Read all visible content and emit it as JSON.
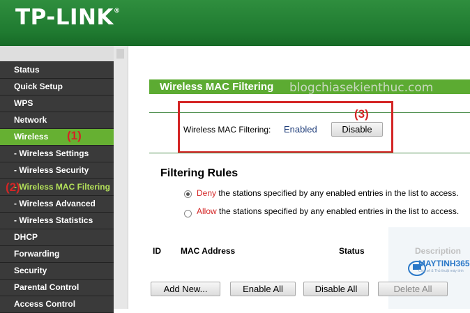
{
  "brand": {
    "name": "TP-LINK",
    "mark": "®"
  },
  "sidebar": {
    "items": [
      {
        "label": "Status"
      },
      {
        "label": "Quick Setup"
      },
      {
        "label": "WPS"
      },
      {
        "label": "Network"
      },
      {
        "label": "Wireless"
      },
      {
        "label": "- Wireless Settings"
      },
      {
        "label": "- Wireless Security"
      },
      {
        "label": "- Wireless MAC Filtering"
      },
      {
        "label": "- Wireless Advanced"
      },
      {
        "label": "- Wireless Statistics"
      },
      {
        "label": "DHCP"
      },
      {
        "label": "Forwarding"
      },
      {
        "label": "Security"
      },
      {
        "label": "Parental Control"
      },
      {
        "label": "Access Control"
      }
    ]
  },
  "annotations": {
    "one": "(1)",
    "two": "(2)",
    "three": "(3)"
  },
  "page": {
    "title": "Wireless MAC Filtering",
    "watermark": "blogchiasekienthuc.com",
    "filtering_label": "Wireless MAC Filtering:",
    "filtering_status": "Enabled",
    "disable_button": "Disable",
    "rules_heading": "Filtering Rules",
    "rule_deny_word": "Deny",
    "rule_deny_rest": " the stations specified by any enabled entries in the list to access.",
    "rule_allow_word": "Allow",
    "rule_allow_rest": " the stations specified by any enabled entries in the list to access.",
    "selected_rule": "deny"
  },
  "table": {
    "headers": {
      "id": "ID",
      "mac": "MAC Address",
      "status": "Status",
      "description": "Description"
    }
  },
  "actions": {
    "add_new": "Add New...",
    "enable_all": "Enable All",
    "disable_all": "Disable All",
    "delete_all": "Delete All"
  },
  "overlay_logo": {
    "name": "MAYTINH365",
    "tagline": "Chia sẻ & Thủ thuật máy tính"
  },
  "colors": {
    "header_green": "#1f7a30",
    "title_green": "#5cab32",
    "active_nav": "#66b032",
    "annotation_red": "#d42525"
  }
}
